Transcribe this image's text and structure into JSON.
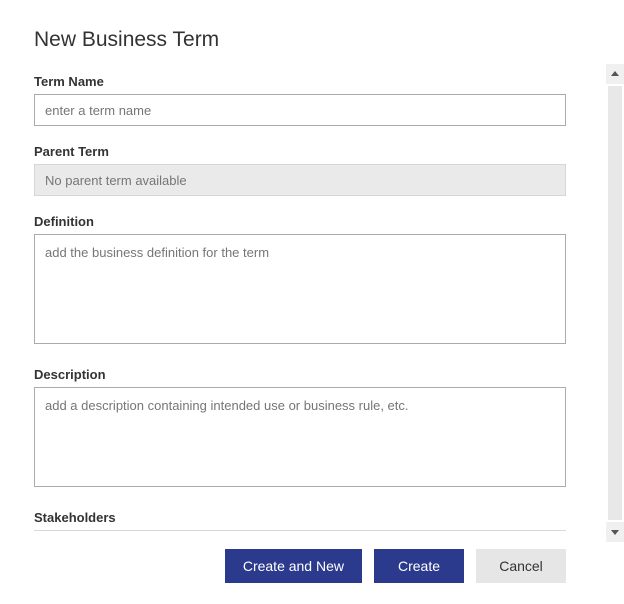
{
  "title": "New Business Term",
  "fields": {
    "termName": {
      "label": "Term Name",
      "placeholder": "enter a term name",
      "value": ""
    },
    "parentTerm": {
      "label": "Parent Term",
      "placeholder": "No parent term available",
      "value": ""
    },
    "definition": {
      "label": "Definition",
      "placeholder": "add the business definition for the term",
      "value": ""
    },
    "description": {
      "label": "Description",
      "placeholder": "add a description containing intended use or business rule, etc.",
      "value": ""
    },
    "stakeholders": {
      "label": "Stakeholders"
    }
  },
  "buttons": {
    "createAndNew": "Create and New",
    "create": "Create",
    "cancel": "Cancel"
  }
}
